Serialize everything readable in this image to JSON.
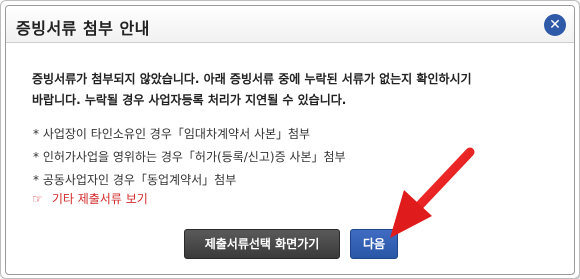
{
  "dialog": {
    "title": "증빙서류 첨부 안내",
    "close_icon": "close-icon"
  },
  "notice": {
    "line1": "증빙서류가 첨부되지 않았습니다. 아래 증빙서류 중에 누락된 서류가 없는지 확인하시기",
    "line2": "바랍니다. 누락될 경우 사업자등록 처리가 지연될 수 있습니다."
  },
  "items": [
    "* 사업장이 타인소유인 경우「임대차계약서 사본」첨부",
    "* 인허가사업을 영위하는 경우「허가(등록/신고)증 사본」첨부",
    "* 공동사업자인 경우「동업계약서」첨부"
  ],
  "other_link": {
    "icon": "hand-pointer-icon",
    "label": "기타 제출서류 보기"
  },
  "buttons": {
    "select_screen": "제출서류선택 화면가기",
    "next": "다음"
  },
  "colors": {
    "accent_blue": "#2e5aa8",
    "link_red": "#d22b2b",
    "annotation_arrow": "#e01b1b"
  }
}
